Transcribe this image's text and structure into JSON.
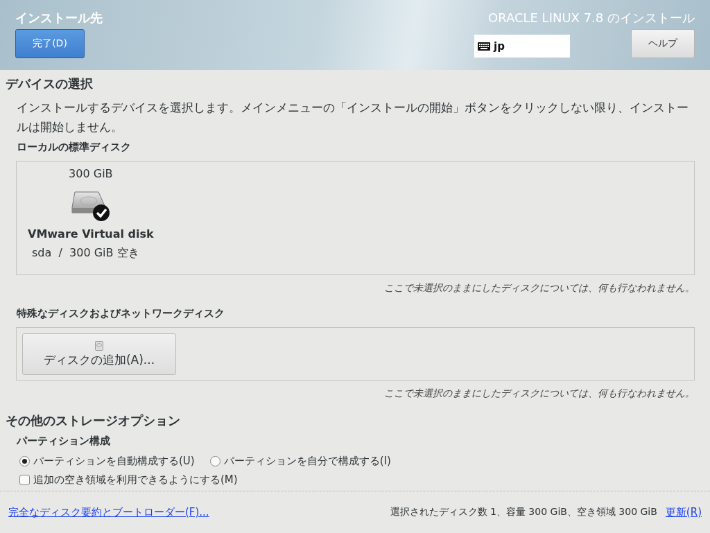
{
  "header": {
    "title": "インストール先",
    "product_title": "ORACLE LINUX 7.8 のインストール",
    "done_button": "完了(D)",
    "keyboard_layout": "jp",
    "help_button": "ヘルプ"
  },
  "device_selection": {
    "heading": "デバイスの選択",
    "description": "インストールするデバイスを選択します。メインメニューの「インストールの開始」ボタンをクリックしない限り、インストールは開始しません。",
    "local_disks": {
      "heading": "ローカルの標準ディスク",
      "disks": [
        {
          "size": "300 GiB",
          "name": "VMware Virtual disk",
          "detail": "sda  /  300 GiB 空き",
          "selected": true
        }
      ],
      "note": "ここで未選択のままにしたディスクについては、何も行なわれません。"
    },
    "special_disks": {
      "heading": "特殊なディスクおよびネットワークディスク",
      "add_button": "ディスクの追加(A)...",
      "note": "ここで未選択のままにしたディスクについては、何も行なわれません。"
    }
  },
  "other_options": {
    "heading": "その他のストレージオプション",
    "partitioning": {
      "heading": "パーティション構成",
      "options": [
        {
          "label": "パーティションを自動構成する(U)",
          "selected": true
        },
        {
          "label": "パーティションを自分で構成する(I)",
          "selected": false
        }
      ]
    },
    "extra_space": {
      "label": "追加の空き領域を利用できるようにする(M)",
      "checked": false
    }
  },
  "footer": {
    "summary_link": "完全なディスク要約とブートローダー(F)...",
    "status": "選択されたディスク数 1、容量 300 GiB、空き領域 300 GiB",
    "refresh_link": "更新(R)"
  }
}
